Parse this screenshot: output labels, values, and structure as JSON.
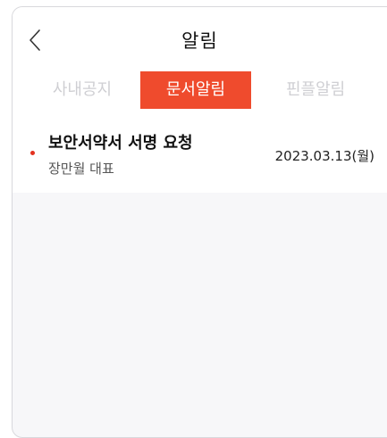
{
  "header": {
    "title": "알림",
    "back_icon": "chevron-left-icon"
  },
  "tabs": [
    {
      "label": "사내공지",
      "active": false
    },
    {
      "label": "문서알림",
      "active": true
    },
    {
      "label": "핀플알림",
      "active": false
    }
  ],
  "accent_color": "#ef4b2d",
  "notifications": [
    {
      "title": "보안서약서 서명 요청",
      "sender": "장만월 대표",
      "date": "2023.03.13(월)",
      "unread": true
    }
  ]
}
